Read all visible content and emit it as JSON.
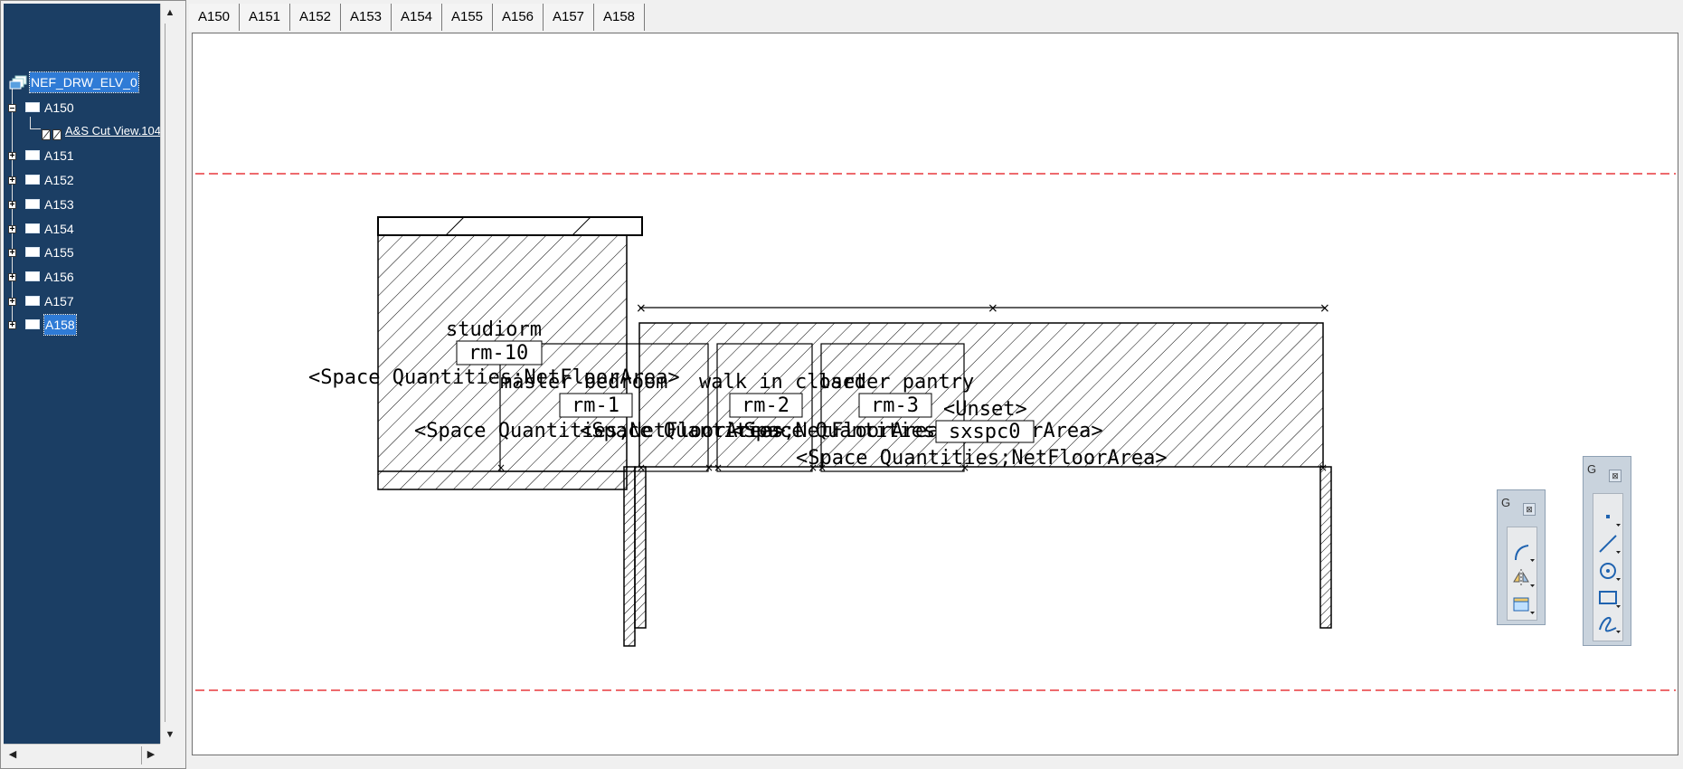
{
  "tree": {
    "root": "NEF_DRW_ELV_0",
    "items": [
      {
        "label": "A150",
        "expanded": true
      },
      {
        "label": "A151"
      },
      {
        "label": "A152"
      },
      {
        "label": "A153"
      },
      {
        "label": "A154"
      },
      {
        "label": "A155"
      },
      {
        "label": "A156"
      },
      {
        "label": "A157"
      },
      {
        "label": "A158",
        "selected": true
      }
    ],
    "child": "A&S Cut View.104"
  },
  "tabs": [
    "A150",
    "A151",
    "A152",
    "A153",
    "A154",
    "A155",
    "A156",
    "A157",
    "A158"
  ],
  "drawing": {
    "rooms": [
      {
        "name": "studiorm",
        "number": "rm-10",
        "area": "<Space Quantities;NetFloorArea>"
      },
      {
        "name": "master bedroom",
        "number": "rm-1",
        "area": "<Space Quantities;NetFloorArea>"
      },
      {
        "name": "walk in closet",
        "number": "rm-2",
        "area": "<Space Quantities;NetFloorArea>"
      },
      {
        "name": "larder pantry",
        "number": "rm-3",
        "area": "<Space Quantities;NetFloorArea>"
      },
      {
        "name": "<Unset>",
        "number": "sxspc0",
        "area": "<Space Quantities;NetFloorArea>"
      }
    ],
    "colors": {
      "level_line": "#e8383d",
      "stroke": "#000000",
      "tree_bg": "#1b3e64",
      "selection": "#2f7bd6"
    }
  },
  "toolbars": {
    "small": {
      "title": "G",
      "close": "⊠",
      "icons": [
        "arc-icon",
        "mirror-icon",
        "frame-icon"
      ]
    },
    "large": {
      "title": "G",
      "close": "⊠",
      "icons": [
        "point-icon",
        "line-icon",
        "circle-icon",
        "rectangle-icon",
        "spline-icon"
      ]
    }
  },
  "scroll": {
    "up": "▲",
    "down": "▼",
    "left": "◀",
    "right": "▶"
  }
}
